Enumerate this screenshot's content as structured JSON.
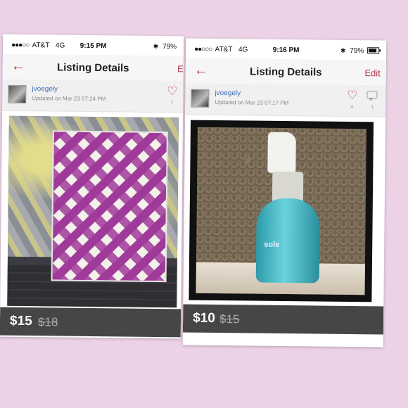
{
  "left": {
    "status": {
      "carrier": "AT&T",
      "network": "4G",
      "time": "9:15 PM",
      "battery": "79%"
    },
    "nav": {
      "title": "Listing Details",
      "edit": "E"
    },
    "user": {
      "name": "jvoegely",
      "updated": "Updated on Mar 23 07:24 PM"
    },
    "likes": "7",
    "price": "$15",
    "original_price": "$18"
  },
  "right": {
    "status": {
      "carrier": "AT&T",
      "network": "4G",
      "time": "9:16 PM",
      "battery": "79%"
    },
    "nav": {
      "title": "Listing Details",
      "edit": "Edit"
    },
    "user": {
      "name": "jvoegely",
      "updated": "Updated on Mar 23 07:17 PM"
    },
    "likes": "4",
    "comments": "1",
    "product_label": "sole",
    "price": "$10",
    "original_price": "$15"
  },
  "icons": {
    "back": "back-arrow-icon",
    "heart": "heart-icon",
    "comment": "comment-icon",
    "bluetooth": "bluetooth-icon",
    "battery": "battery-icon",
    "signal": "signal-dots-icon"
  },
  "colors": {
    "accent": "#b5354a",
    "link": "#3a6fb5",
    "pricebar": "#464646",
    "background": "#ecd2e7"
  }
}
